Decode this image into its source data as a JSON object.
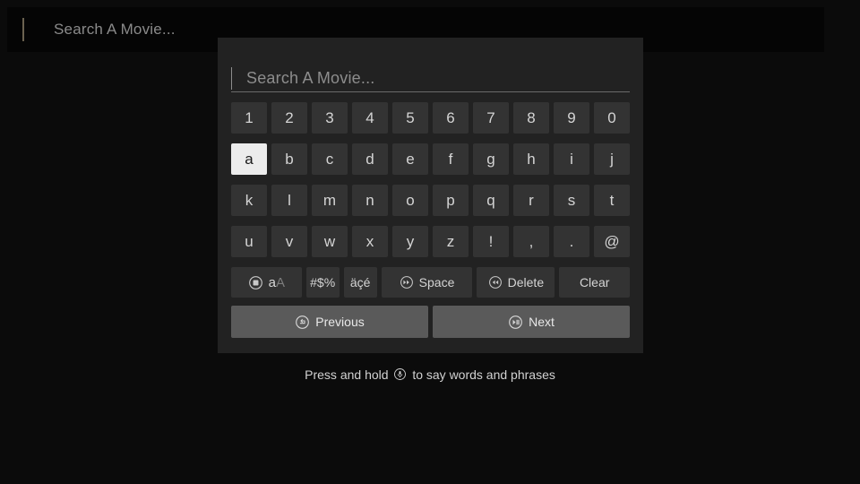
{
  "topbar": {
    "placeholder": "Search A Movie...",
    "caret_color": "#6b6250"
  },
  "dialog": {
    "search_field": {
      "placeholder": "Search A Movie...",
      "value": ""
    },
    "keyboard": {
      "rows": [
        {
          "name": "digits",
          "keys": [
            "1",
            "2",
            "3",
            "4",
            "5",
            "6",
            "7",
            "8",
            "9",
            "0"
          ]
        },
        {
          "name": "letters-1",
          "keys": [
            "a",
            "b",
            "c",
            "d",
            "e",
            "f",
            "g",
            "h",
            "i",
            "j"
          ]
        },
        {
          "name": "letters-2",
          "keys": [
            "k",
            "l",
            "m",
            "n",
            "o",
            "p",
            "q",
            "r",
            "s",
            "t"
          ]
        },
        {
          "name": "letters-3",
          "keys": [
            "u",
            "v",
            "w",
            "x",
            "y",
            "z",
            "!",
            ",",
            ".",
            "@"
          ]
        }
      ],
      "selected_key": "a"
    },
    "function_row": [
      {
        "name": "case-toggle",
        "label": "aA",
        "lower": "a",
        "upper": "A",
        "icon": "circle-square-icon"
      },
      {
        "name": "symbols",
        "label": "#$%",
        "icon": ""
      },
      {
        "name": "accents",
        "label": "äçé",
        "icon": ""
      },
      {
        "name": "space",
        "label": "Space",
        "icon": "circle-fast-forward-icon"
      },
      {
        "name": "delete",
        "label": "Delete",
        "icon": "circle-rewind-icon"
      },
      {
        "name": "clear",
        "label": "Clear",
        "icon": ""
      }
    ],
    "nav_buttons": [
      {
        "name": "previous",
        "label": "Previous",
        "icon": "circle-back-arrow-icon"
      },
      {
        "name": "next",
        "label": "Next",
        "icon": "circle-play-pause-icon"
      }
    ]
  },
  "hint": {
    "before": "Press and hold",
    "after": "to say words and phrases",
    "icon": "circle-microphone-icon"
  },
  "colors": {
    "page_background": "#0b0b0b",
    "topbar_background": "#050505",
    "dialog_background": "#222222",
    "key_background": "#333333",
    "key_selected_background": "#ececec",
    "nav_button_background": "#5a5a5a",
    "key_text": "#d4d4d4",
    "placeholder_text": "#8d8d8d"
  }
}
